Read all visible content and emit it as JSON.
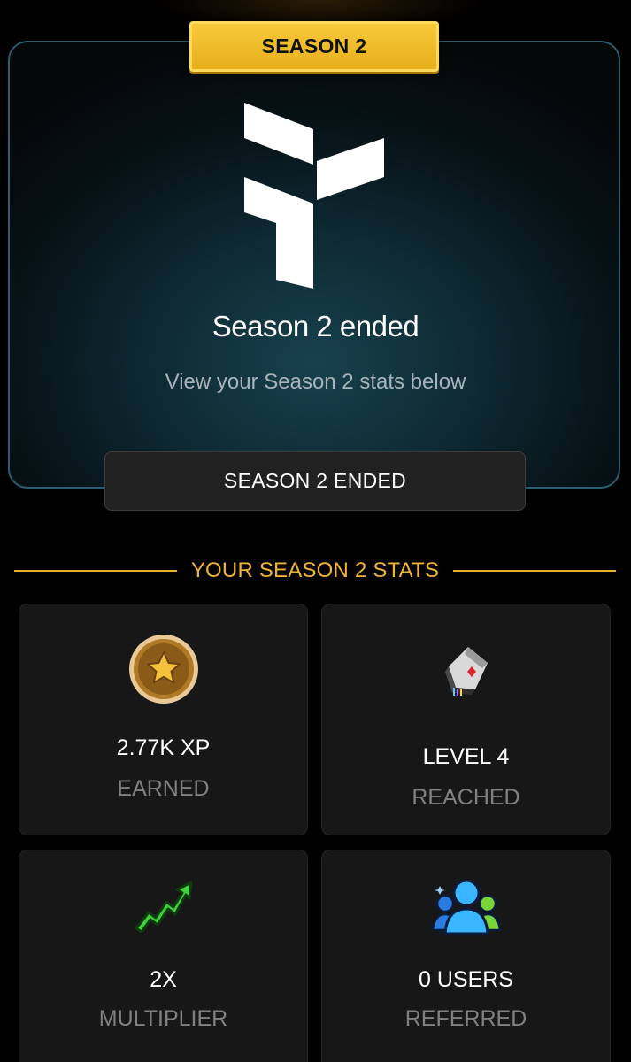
{
  "season_badge": "SEASON 2",
  "hero": {
    "title": "Season 2 ended",
    "subtitle": "View your Season 2 stats below",
    "button_label": "SEASON 2 ENDED"
  },
  "stats_header": "YOUR SEASON 2 STATS",
  "stats": [
    {
      "value": "2.77K XP",
      "label": "EARNED",
      "icon": "star-coin-icon"
    },
    {
      "value": "LEVEL 4",
      "label": "REACHED",
      "icon": "level-card-icon"
    },
    {
      "value": "2X",
      "label": "MULTIPLIER",
      "icon": "trend-up-arrow-icon"
    },
    {
      "value": "0 USERS",
      "label": "REFERRED",
      "icon": "users-group-icon"
    }
  ],
  "colors": {
    "accent_gold": "#f0b334",
    "badge_yellow": "#f7c93c",
    "card_bg": "#171717",
    "hero_teal": "#17414d"
  }
}
